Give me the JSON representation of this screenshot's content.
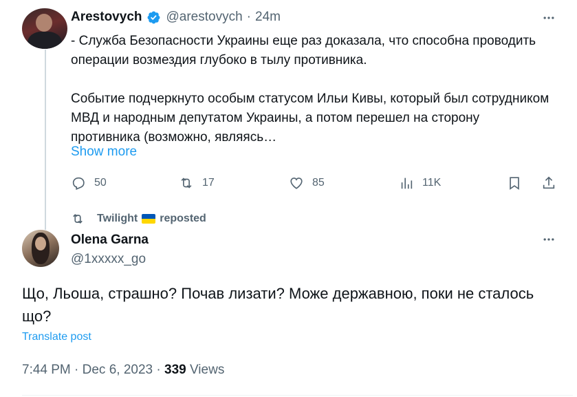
{
  "tweet": {
    "author_name": "Arestovych",
    "handle": "@arestovych",
    "separator": "·",
    "time": "24m",
    "text": "- Служба Безопасности Украины еще раз доказала, что способна проводить операции возмездия глубоко в тылу противника.\n\nСобытие подчеркнуто особым статусом Ильи Кивы, который был сотрудником МВД и народным депутатом Украины, а потом перешел на сторону противника (возможно, являясь…",
    "show_more": "Show more",
    "replies": "50",
    "reposts": "17",
    "likes": "85",
    "views": "11K",
    "verified_color": "#1d9bf0"
  },
  "repost": {
    "by": "Twilight",
    "label": "reposted"
  },
  "reply": {
    "author_name": "Olena Garna",
    "handle": "@1xxxxx_go",
    "text": "Що, Льоша, страшно? Почав лизати? Може державною, поки не сталось що?",
    "translate": "Translate post",
    "timestamp": "7:44 PM · Dec 6, 2023 · ",
    "view_count": "339",
    "views_label": " Views"
  },
  "icons": {
    "verified": "verified-badge-icon",
    "more": "more-icon",
    "reply": "reply-icon",
    "repost": "repost-icon",
    "like": "heart-icon",
    "views": "views-icon",
    "bookmark": "bookmark-icon",
    "share": "share-icon",
    "flag": "ukraine-flag-icon"
  },
  "colors": {
    "link": "#1d9bf0",
    "muted": "#536471",
    "text": "#0f1419",
    "flag_blue": "#0057b7",
    "flag_yellow": "#ffd700"
  }
}
